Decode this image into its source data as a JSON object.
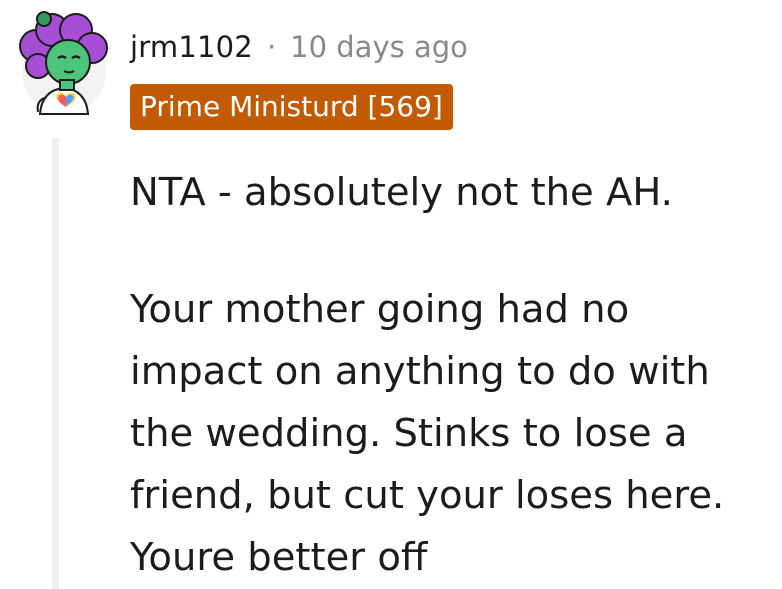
{
  "comment": {
    "author": "jrm1102",
    "separator": "·",
    "timestamp": "10 days ago",
    "flair": "Prime Ministurd [569]",
    "paragraphs": [
      "NTA - absolutely not the AH.",
      "Your mother going had no impact on anything to do with the wedding. Stinks to lose a friend, but cut your loses here. Youre better off"
    ]
  },
  "colors": {
    "flair_bg": "#c15a00",
    "meta_text": "#878a8c",
    "thread_line": "#edeff1",
    "avatar_hair": "#a64fd6",
    "avatar_skin": "#4cc47b"
  },
  "icons": {
    "avatar": "snoo-avatar-icon",
    "heart": "rainbow-heart-icon"
  }
}
